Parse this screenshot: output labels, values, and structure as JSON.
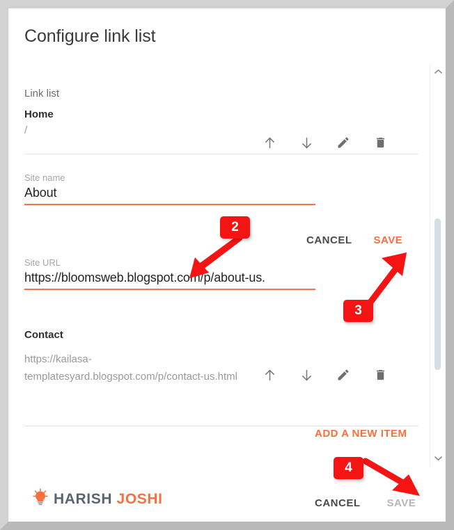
{
  "dialog": {
    "title": "Configure link list",
    "section_label": "Link list"
  },
  "links": [
    {
      "name": "Home",
      "url": "/",
      "actions": [
        "move-up",
        "move-down",
        "edit",
        "delete"
      ]
    },
    {
      "name": "Contact",
      "url": "https://kailasa-templatesyard.blogspot.com/p/contact-us.html",
      "actions": [
        "move-up",
        "move-down",
        "edit",
        "delete"
      ]
    }
  ],
  "edit_form": {
    "site_name_label": "Site name",
    "site_name_value": "About",
    "site_name_placeholder": "Site name",
    "site_url_label": "Site URL",
    "site_url_value": "https://bloomsweb.blogspot.com/p/about-us.",
    "site_url_placeholder": "Site URL",
    "cancel_label": "CANCEL",
    "save_label": "SAVE"
  },
  "add_item_label": "ADD A NEW ITEM",
  "footer": {
    "logo_icon": "lightbulb-icon",
    "logo_primary": "HARISH",
    "logo_secondary": "JOSHI",
    "cancel_label": "CANCEL",
    "save_label": "SAVE"
  },
  "scrollbar": {
    "up_icon": "chevron-up-icon",
    "down_icon": "chevron-down-icon"
  },
  "annotations": [
    {
      "number": "2",
      "target": "site-url-input"
    },
    {
      "number": "3",
      "target": "edit-form-save-button"
    },
    {
      "number": "4",
      "target": "footer-save-button"
    }
  ],
  "colors": {
    "accent": "#f9703e",
    "field_underline": "#f4704a",
    "annotation": "#f41414",
    "text_primary": "#2e2e2e",
    "text_muted": "#9a9a9a",
    "logo_primary": "#5a6472",
    "logo_secondary": "#f9703e"
  }
}
